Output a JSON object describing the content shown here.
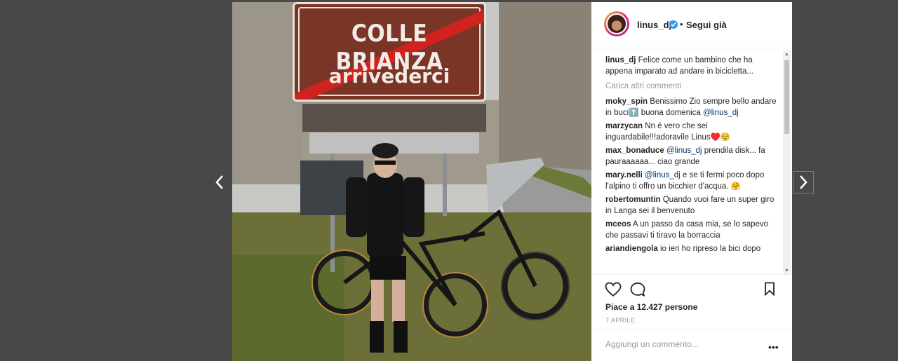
{
  "post": {
    "photo": {
      "sign_town": "COLLE BRIANZA",
      "sign_bye": "arrivederci"
    },
    "header": {
      "username": "linus_dj",
      "separator": "•",
      "follow_label": "Segui già"
    },
    "caption": {
      "user": "linus_dj",
      "text": "Felice come un bambino che ha appena imparato ad andare in bicicletta..."
    },
    "load_more": "Carica altri commenti",
    "comments": [
      {
        "user": "moky_spin",
        "text": "Benissimo Zio sempre bello andare in buci⬆️ buona domenica ",
        "mention": "@linus_dj",
        "after": ""
      },
      {
        "user": "marzycan",
        "text": "Nn é vero che sei inguardabile!!!adoravile Linus♥️☺️",
        "mention": "",
        "after": ""
      },
      {
        "user": "max_bonaduce",
        "text": "",
        "mention": "@linus_dj",
        "after": " prendila disk... fa pauraaaaaa... ciao grande"
      },
      {
        "user": "mary.nelli",
        "text": "",
        "mention": "@linus_dj",
        "after": " e se ti fermi poco dopo l'alpino ti offro un bicchier d'acqua. 🤗"
      },
      {
        "user": "robertomuntin",
        "text": "Quando vuoi fare un super giro in Langa sei il benvenuto",
        "mention": "",
        "after": ""
      },
      {
        "user": "mceos",
        "text": "A un passo da casa mia, se lo sapevo che passavi ti tiravo la borraccia",
        "mention": "",
        "after": ""
      },
      {
        "user": "ariandiengola",
        "text": "io ieri ho ripreso la bici dopo",
        "mention": "",
        "after": ""
      }
    ],
    "likes": "Piace a 12.427 persone",
    "date": "7 APRILE",
    "comment_input": {
      "placeholder": "Aggiungi un commento...",
      "value": ""
    },
    "icons": {
      "prev": "chevron-left-icon",
      "next": "chevron-right-icon",
      "like": "heart-icon",
      "comment": "comment-bubble-icon",
      "save": "bookmark-icon",
      "more": "more-dots-icon",
      "verified": "verified-badge-icon"
    },
    "colors": {
      "backdrop": "#484848",
      "panel": "#ffffff",
      "link": "#003569",
      "verified": "#3897f0",
      "muted": "#999999"
    }
  }
}
